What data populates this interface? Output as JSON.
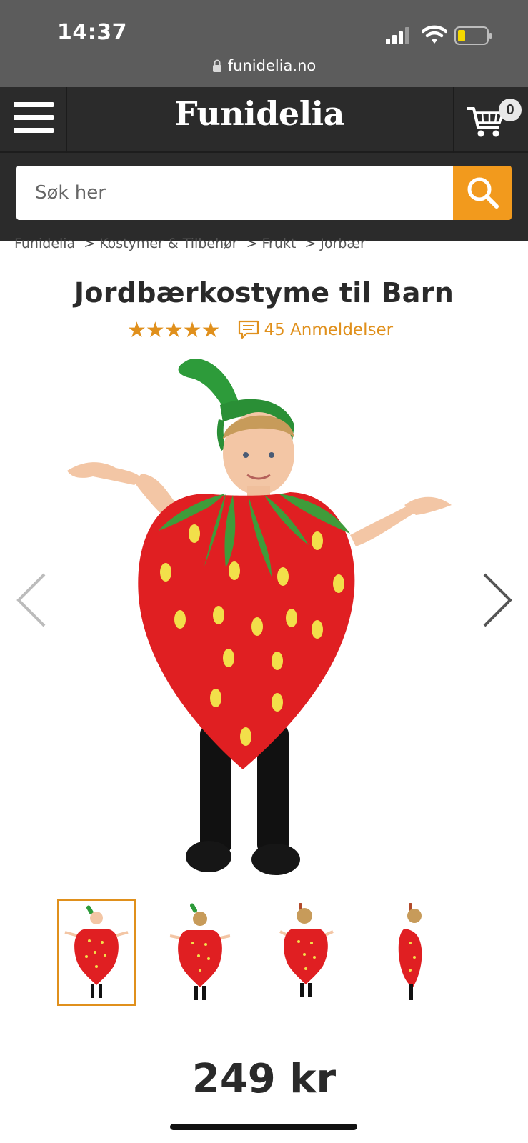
{
  "status_bar": {
    "time": "14:37",
    "url": "funidelia.no",
    "icons": [
      "signal-icon",
      "wifi-icon",
      "battery-icon",
      "lock-icon"
    ]
  },
  "header": {
    "logo": "Funidelia",
    "cart_count": "0",
    "icons": [
      "hamburger-menu-icon",
      "cart-icon"
    ]
  },
  "search": {
    "placeholder": "Søk her",
    "icon": "search-icon"
  },
  "breadcrumb": [
    "Funidelia",
    "Kostymer & Tilbehør",
    "Frukt",
    "Jorbær"
  ],
  "product": {
    "title": "Jordbærkostyme til Barn",
    "stars": "★★★★★",
    "rating": 5,
    "reviews": "45 Anmeldelser",
    "price": "249 kr",
    "thumbnail_count": 4,
    "selected_thumbnail": 1
  },
  "colors": {
    "accent": "#f29a1d",
    "star": "#e0901c",
    "header_bg": "#2b2b2b",
    "statusbar_bg": "#5c5c5c"
  }
}
